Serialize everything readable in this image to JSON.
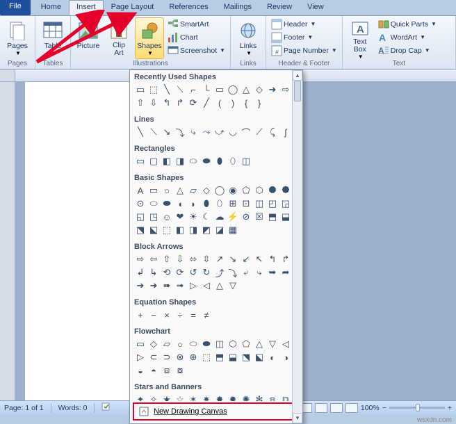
{
  "tabs": [
    "File",
    "Home",
    "Insert",
    "Page Layout",
    "References",
    "Mailings",
    "Review",
    "View"
  ],
  "active_tab": "Insert",
  "ribbon": {
    "pages": {
      "label": "Pages",
      "btn": "Pages"
    },
    "tables": {
      "label": "Tables",
      "btn": "Table"
    },
    "illustrations": {
      "label": "Illustrations",
      "picture": "Picture",
      "clipart": "Clip\nArt",
      "shapes": "Shapes",
      "smartart": "SmartArt",
      "chart": "Chart",
      "screenshot": "Screenshot"
    },
    "links": {
      "label": "Links",
      "btn": "Links"
    },
    "headerfooter": {
      "label": "Header & Footer",
      "header": "Header",
      "footer": "Footer",
      "page_number": "Page Number"
    },
    "text": {
      "label": "Text",
      "textbox": "Text\nBox",
      "quickparts": "Quick Parts",
      "wordart": "WordArt",
      "dropcap": "Drop Cap"
    }
  },
  "shapes_menu": {
    "categories": [
      {
        "name": "Recently Used Shapes",
        "count": 22
      },
      {
        "name": "Lines",
        "count": 12
      },
      {
        "name": "Rectangles",
        "count": 9
      },
      {
        "name": "Basic Shapes",
        "count": 44
      },
      {
        "name": "Block Arrows",
        "count": 32
      },
      {
        "name": "Equation Shapes",
        "count": 6
      },
      {
        "name": "Flowchart",
        "count": 28
      },
      {
        "name": "Stars and Banners",
        "count": 20
      }
    ],
    "new_canvas": "New Drawing Canvas"
  },
  "status": {
    "page": "Page: 1 of 1",
    "words": "Words: 0",
    "zoom": "100%",
    "zoom_value": 100
  },
  "watermark": "wsxdn.com"
}
